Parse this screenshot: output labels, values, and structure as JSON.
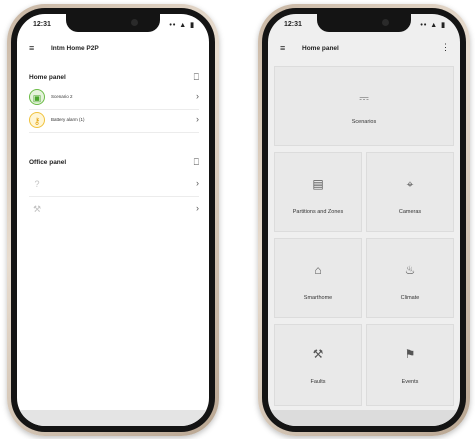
{
  "left_phone": {
    "status": {
      "time": "12:31",
      "icons": "•• ▲ ▮"
    },
    "header": {
      "menu_glyph": "≡",
      "title": "Intm Home P2P"
    },
    "home_section": {
      "title": "Home panel",
      "icon": "panel-icon",
      "icon_glyph": "⎕",
      "items": [
        {
          "label": "Scenario 2",
          "icon": "scenario-icon",
          "glyph": "▣",
          "color": "#6cbc48"
        },
        {
          "label": "Battery alarm (1)",
          "icon": "key-icon",
          "glyph": "⚷",
          "color": "#f0c23d"
        }
      ]
    },
    "office_section": {
      "title": "Office panel",
      "icon": "panel-icon",
      "icon_glyph": "⎕",
      "items": [
        {
          "label": "",
          "icon": "question-icon",
          "glyph": "?"
        },
        {
          "label": "",
          "icon": "tool-icon",
          "glyph": "⚒"
        }
      ]
    },
    "chevron_glyph": "›"
  },
  "right_phone": {
    "status": {
      "time": "12:31",
      "icons": "•• ▲ ▮"
    },
    "header": {
      "menu_glyph": "≡",
      "title": "Home panel",
      "more_glyph": "⋮"
    },
    "tiles": [
      {
        "label": "Scenarios",
        "icon": "clapperboard-icon",
        "glyph": "⎓"
      },
      {
        "label": "Partitions and Zones",
        "icon": "partition-icon",
        "glyph": "▤"
      },
      {
        "label": "Cameras",
        "icon": "camera-icon",
        "glyph": "⌖"
      },
      {
        "label": "Smarthome",
        "icon": "house-icon",
        "glyph": "⌂"
      },
      {
        "label": "Climate",
        "icon": "thermometer-icon",
        "glyph": "♨"
      },
      {
        "label": "Faults",
        "icon": "wrench-icon",
        "glyph": "⚒"
      },
      {
        "label": "Events",
        "icon": "megaphone-icon",
        "glyph": "⚑"
      }
    ]
  }
}
